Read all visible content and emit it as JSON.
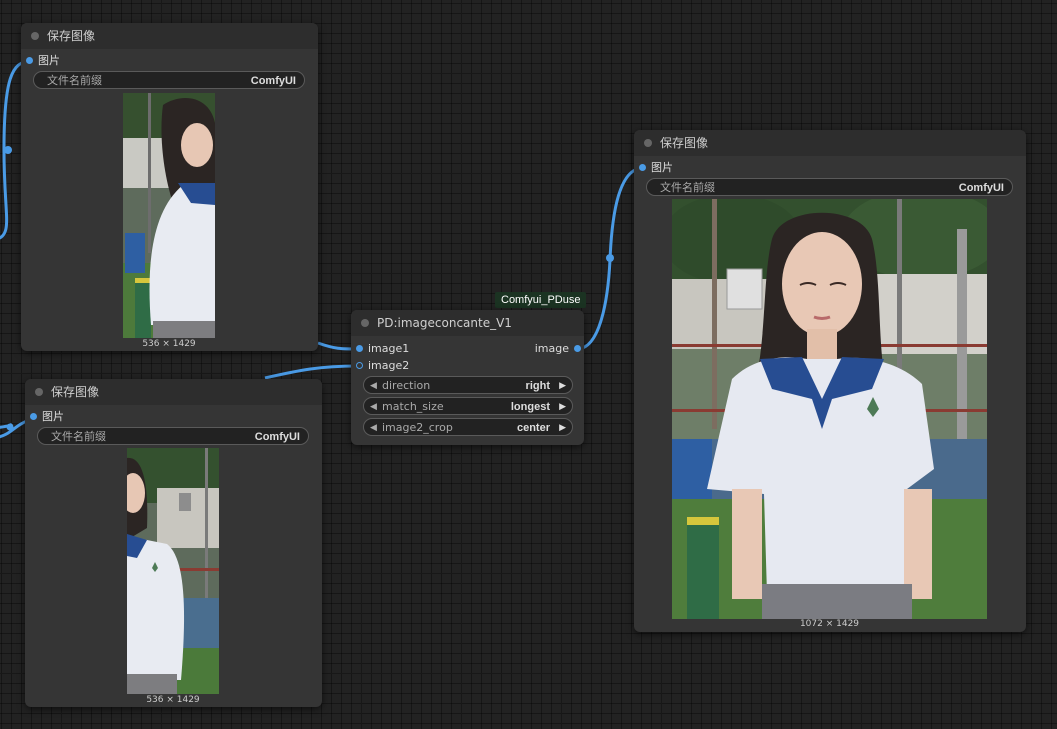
{
  "nodes": {
    "save_top": {
      "title": "保存图像",
      "input_label": "图片",
      "filename_label": "文件名前缀",
      "filename_value": "ComfyUI",
      "image_dims": "536 × 1429"
    },
    "save_bottom": {
      "title": "保存图像",
      "input_label": "图片",
      "filename_label": "文件名前缀",
      "filename_value": "ComfyUI",
      "image_dims": "536 × 1429"
    },
    "save_right": {
      "title": "保存图像",
      "input_label": "图片",
      "filename_label": "文件名前缀",
      "filename_value": "ComfyUI",
      "image_dims": "1072 × 1429"
    },
    "concat": {
      "badge": "Comfyui_PDuse",
      "title": "PD:imageconcante_V1",
      "input1": "image1",
      "input2": "image2",
      "output": "image",
      "widgets": [
        {
          "label": "direction",
          "value": "right"
        },
        {
          "label": "match_size",
          "value": "longest"
        },
        {
          "label": "image2_crop",
          "value": "center"
        }
      ]
    }
  },
  "colors": {
    "link": "#4a9be6",
    "badge_bg": "#1b3322",
    "node_bg": "#353535",
    "canvas_bg": "#222222"
  }
}
